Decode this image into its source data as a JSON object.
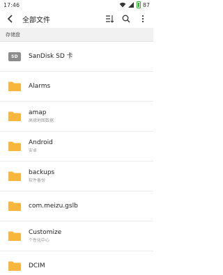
{
  "status_bar": {
    "time": "17:46",
    "battery": "87"
  },
  "header": {
    "title": "全部文件"
  },
  "breadcrumb": {
    "label": "存储盘"
  },
  "folder_color": "#f6b73c",
  "sd_card": {
    "name": "SanDisk SD 卡",
    "badge": "SD"
  },
  "folders": [
    {
      "name": "Alarms",
      "sub": ""
    },
    {
      "name": "amap",
      "sub": "高德地图数据"
    },
    {
      "name": "Android",
      "sub": "安卓"
    },
    {
      "name": "backups",
      "sub": "软件备份"
    },
    {
      "name": "com.meizu.gslb",
      "sub": ""
    },
    {
      "name": "Customize",
      "sub": "个性化中心"
    },
    {
      "name": "DCIM",
      "sub": ""
    }
  ]
}
